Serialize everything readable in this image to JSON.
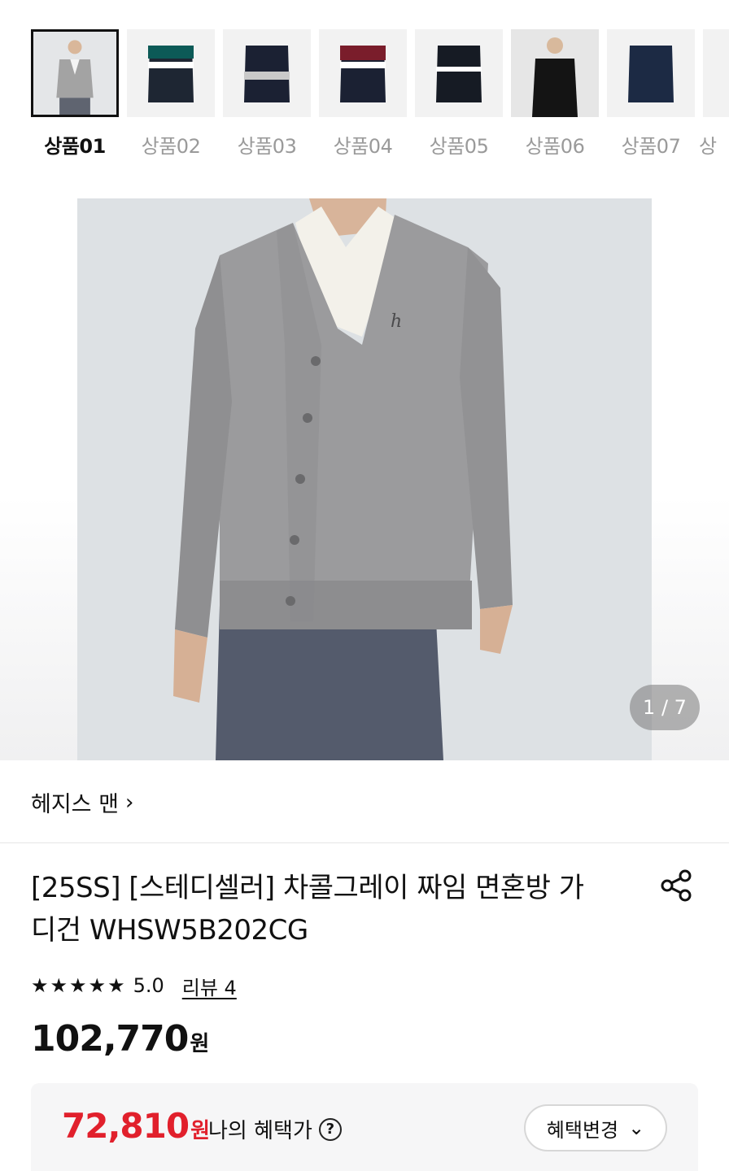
{
  "thumbnails": [
    {
      "label": "상품01",
      "selected": true
    },
    {
      "label": "상품02",
      "selected": false
    },
    {
      "label": "상품03",
      "selected": false
    },
    {
      "label": "상품04",
      "selected": false
    },
    {
      "label": "상품05",
      "selected": false
    },
    {
      "label": "상품06",
      "selected": false
    },
    {
      "label": "상품07",
      "selected": false
    },
    {
      "label": "상",
      "selected": false
    }
  ],
  "gallery": {
    "counter": "1 / 7"
  },
  "brand": {
    "name": "헤지스 맨",
    "chevron": "›"
  },
  "product": {
    "title_line1": "[25SS] [스테디셀러] 차콜그레이 짜임 면혼방 가",
    "title_line2": "디건 WHSW5B202CG",
    "stars": "★★★★★",
    "rating": "5.0",
    "review_link": "리뷰 4",
    "price_value": "102,770",
    "price_unit": "원"
  },
  "benefit": {
    "price_value": "72,810",
    "price_unit": "원",
    "label": "나의 혜택가",
    "help_icon": "?",
    "change_button": "혜택변경",
    "change_chevron": "⌄"
  },
  "colors": {
    "accent_red": "#e1202c",
    "text": "#111111",
    "muted": "#9a9a9a"
  }
}
